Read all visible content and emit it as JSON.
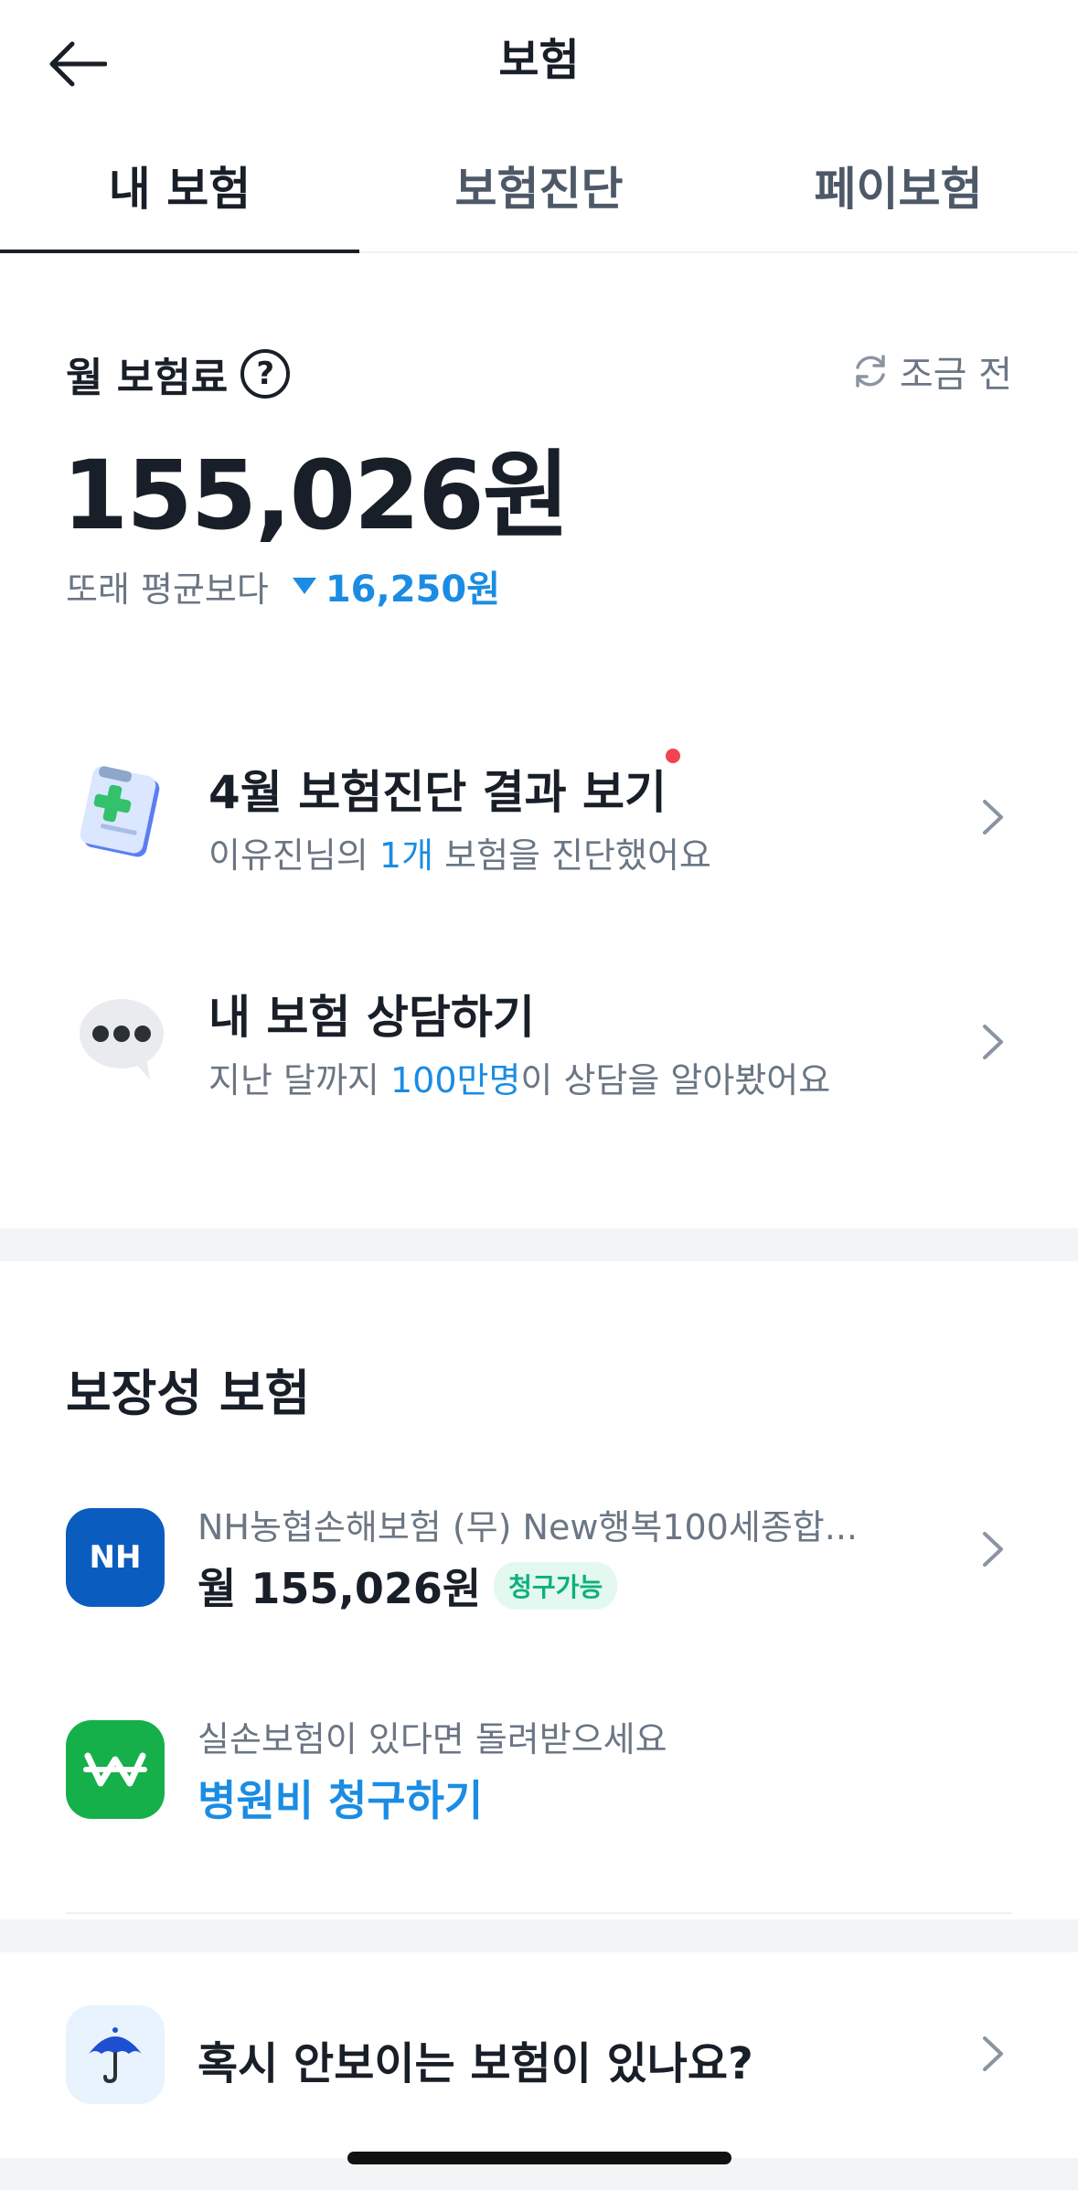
{
  "header": {
    "title": "보험",
    "back_icon": "arrow-left-icon"
  },
  "tabs": [
    {
      "label": "내 보험",
      "active": true
    },
    {
      "label": "보험진단",
      "active": false
    },
    {
      "label": "페이보험",
      "active": false
    }
  ],
  "summary": {
    "label": "월 보험료",
    "help_glyph": "?",
    "refresh_text": "조금 전",
    "amount": "155,026원",
    "compare_label": "또래 평균보다",
    "compare_value": "16,250원"
  },
  "menus": [
    {
      "title": "4월 보험진단 결과 보기",
      "desc_prefix": "이유진님의 ",
      "desc_highlight": "1개",
      "desc_suffix": " 보험을 진단했어요",
      "icon": "clipboard-medical-icon",
      "has_new_dot": true
    },
    {
      "title": "내 보험 상담하기",
      "desc_prefix": "지난 달까지 ",
      "desc_highlight": "100만명",
      "desc_suffix": "이 상담을 알아봤어요",
      "icon": "chat-bubble-icon"
    }
  ],
  "coverage": {
    "section_title": "보장성 보험",
    "items": [
      {
        "logo_text": "NH",
        "subtitle": "NH농협손해보험  (무) New행복100세종합...",
        "main": "월 155,026원",
        "badge": "청구가능"
      },
      {
        "logo_icon": "won-sign-icon",
        "subtitle": "실손보험이 있다면 돌려받으세요",
        "main": "병원비 청구하기"
      }
    ]
  },
  "missing": {
    "text": "혹시 안보이는 보험이 있나요?",
    "icon": "umbrella-icon"
  },
  "colors": {
    "accent": "#1b8ce3",
    "text": "#191f28",
    "sub": "#6b7684",
    "badge": "#0db07d",
    "nh": "#0a5cbf",
    "green": "#16b04b"
  }
}
